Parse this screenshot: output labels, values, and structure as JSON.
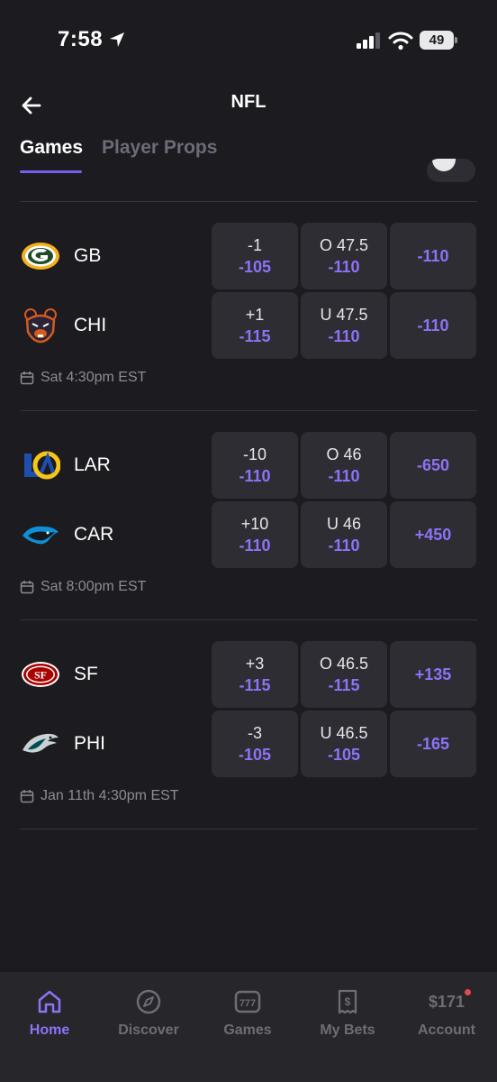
{
  "status": {
    "time": "7:58",
    "battery": "49"
  },
  "header": {
    "title": "NFL"
  },
  "tabs": [
    {
      "label": "Games"
    },
    {
      "label": "Player Props"
    }
  ],
  "games": [
    {
      "time": "Sat 4:30pm EST",
      "teams": [
        {
          "abbr": "GB",
          "spread": "-1",
          "spread_odds": "-105",
          "total": "O 47.5",
          "total_odds": "-110",
          "moneyline": "-110"
        },
        {
          "abbr": "CHI",
          "spread": "+1",
          "spread_odds": "-115",
          "total": "U 47.5",
          "total_odds": "-110",
          "moneyline": "-110"
        }
      ]
    },
    {
      "time": "Sat 8:00pm EST",
      "teams": [
        {
          "abbr": "LAR",
          "spread": "-10",
          "spread_odds": "-110",
          "total": "O 46",
          "total_odds": "-110",
          "moneyline": "-650"
        },
        {
          "abbr": "CAR",
          "spread": "+10",
          "spread_odds": "-110",
          "total": "U 46",
          "total_odds": "-110",
          "moneyline": "+450"
        }
      ]
    },
    {
      "time": "Jan 11th 4:30pm EST",
      "teams": [
        {
          "abbr": "SF",
          "spread": "+3",
          "spread_odds": "-115",
          "total": "O 46.5",
          "total_odds": "-115",
          "moneyline": "+135"
        },
        {
          "abbr": "PHI",
          "spread": "-3",
          "spread_odds": "-105",
          "total": "U 46.5",
          "total_odds": "-105",
          "moneyline": "-165"
        }
      ]
    }
  ],
  "nav": {
    "home": "Home",
    "discover": "Discover",
    "games": "Games",
    "mybets": "My Bets",
    "account": "Account",
    "balance": "$171"
  },
  "colors": {
    "accent": "#8e72f7",
    "background": "#1c1b1f",
    "cell": "#2e2d33"
  }
}
